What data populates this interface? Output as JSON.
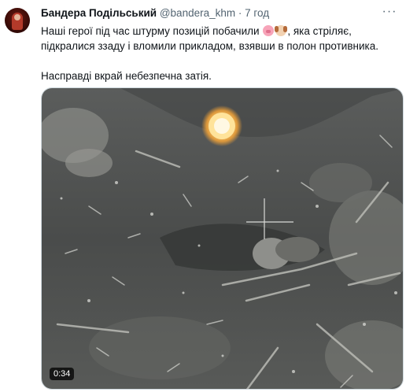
{
  "tweet": {
    "author_name": "Бандера Подільський",
    "handle": "@bandera_khm",
    "separator": "·",
    "time": "7 год",
    "more_label": "···",
    "text_line1_before": "Наші герої під час штурму позицій побачили",
    "text_line1_after": ", яка стріляє,",
    "text_line2": "підкралися ззаду і вломили прикладом, взявши в полон противника.",
    "text_paragraph2": "Насправді вкрай небезпечна затія.",
    "emojis": [
      "pig-face-emoji",
      "dog-face-emoji"
    ]
  },
  "media": {
    "type": "video",
    "duration": "0:34"
  }
}
